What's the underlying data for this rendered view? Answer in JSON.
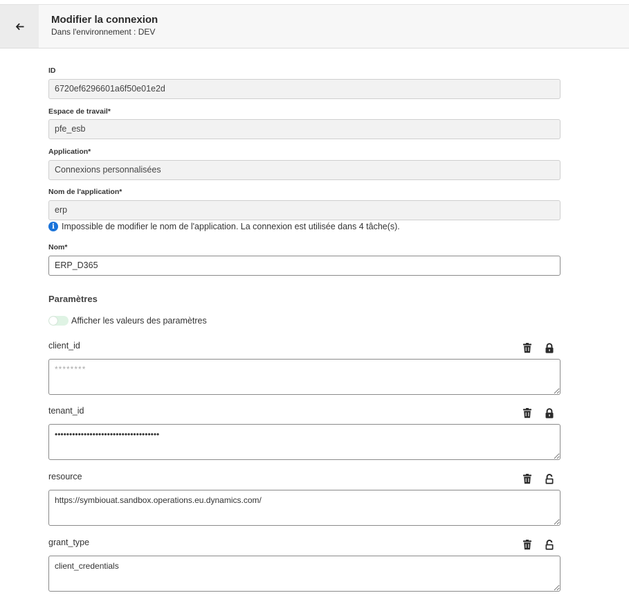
{
  "header": {
    "title": "Modifier la connexion",
    "subtitle": "Dans l'environnement : DEV"
  },
  "fields": {
    "id": {
      "label": "ID",
      "value": "6720ef6296601a6f50e01e2d"
    },
    "workspace": {
      "label": "Espace de travail*",
      "value": "pfe_esb"
    },
    "application": {
      "label": "Application*",
      "value": "Connexions personnalisées"
    },
    "app_name": {
      "label": "Nom de l'application*",
      "value": "erp"
    },
    "app_name_info": "Impossible de modifier le nom de l'application. La connexion est utilisée dans 4 tâche(s).",
    "name": {
      "label": "Nom*",
      "value": "ERP_D365"
    }
  },
  "parameters": {
    "title": "Paramètres",
    "toggle_label": "Afficher les valeurs des paramètres",
    "items": [
      {
        "key": "client_id",
        "value": "",
        "placeholder": "********",
        "locked": true
      },
      {
        "key": "tenant_id",
        "value": "••••••••••••••••••••••••••••••••••••",
        "placeholder": "",
        "locked": true
      },
      {
        "key": "resource",
        "value": "https://symbiouat.sandbox.operations.eu.dynamics.com/",
        "placeholder": "",
        "locked": false
      },
      {
        "key": "grant_type",
        "value": "client_credentials",
        "placeholder": "",
        "locked": false
      }
    ]
  },
  "colors": {
    "info": "#1a73d9",
    "toggle_off": "#dff3e4",
    "readonly_bg": "#f2f2f2"
  }
}
